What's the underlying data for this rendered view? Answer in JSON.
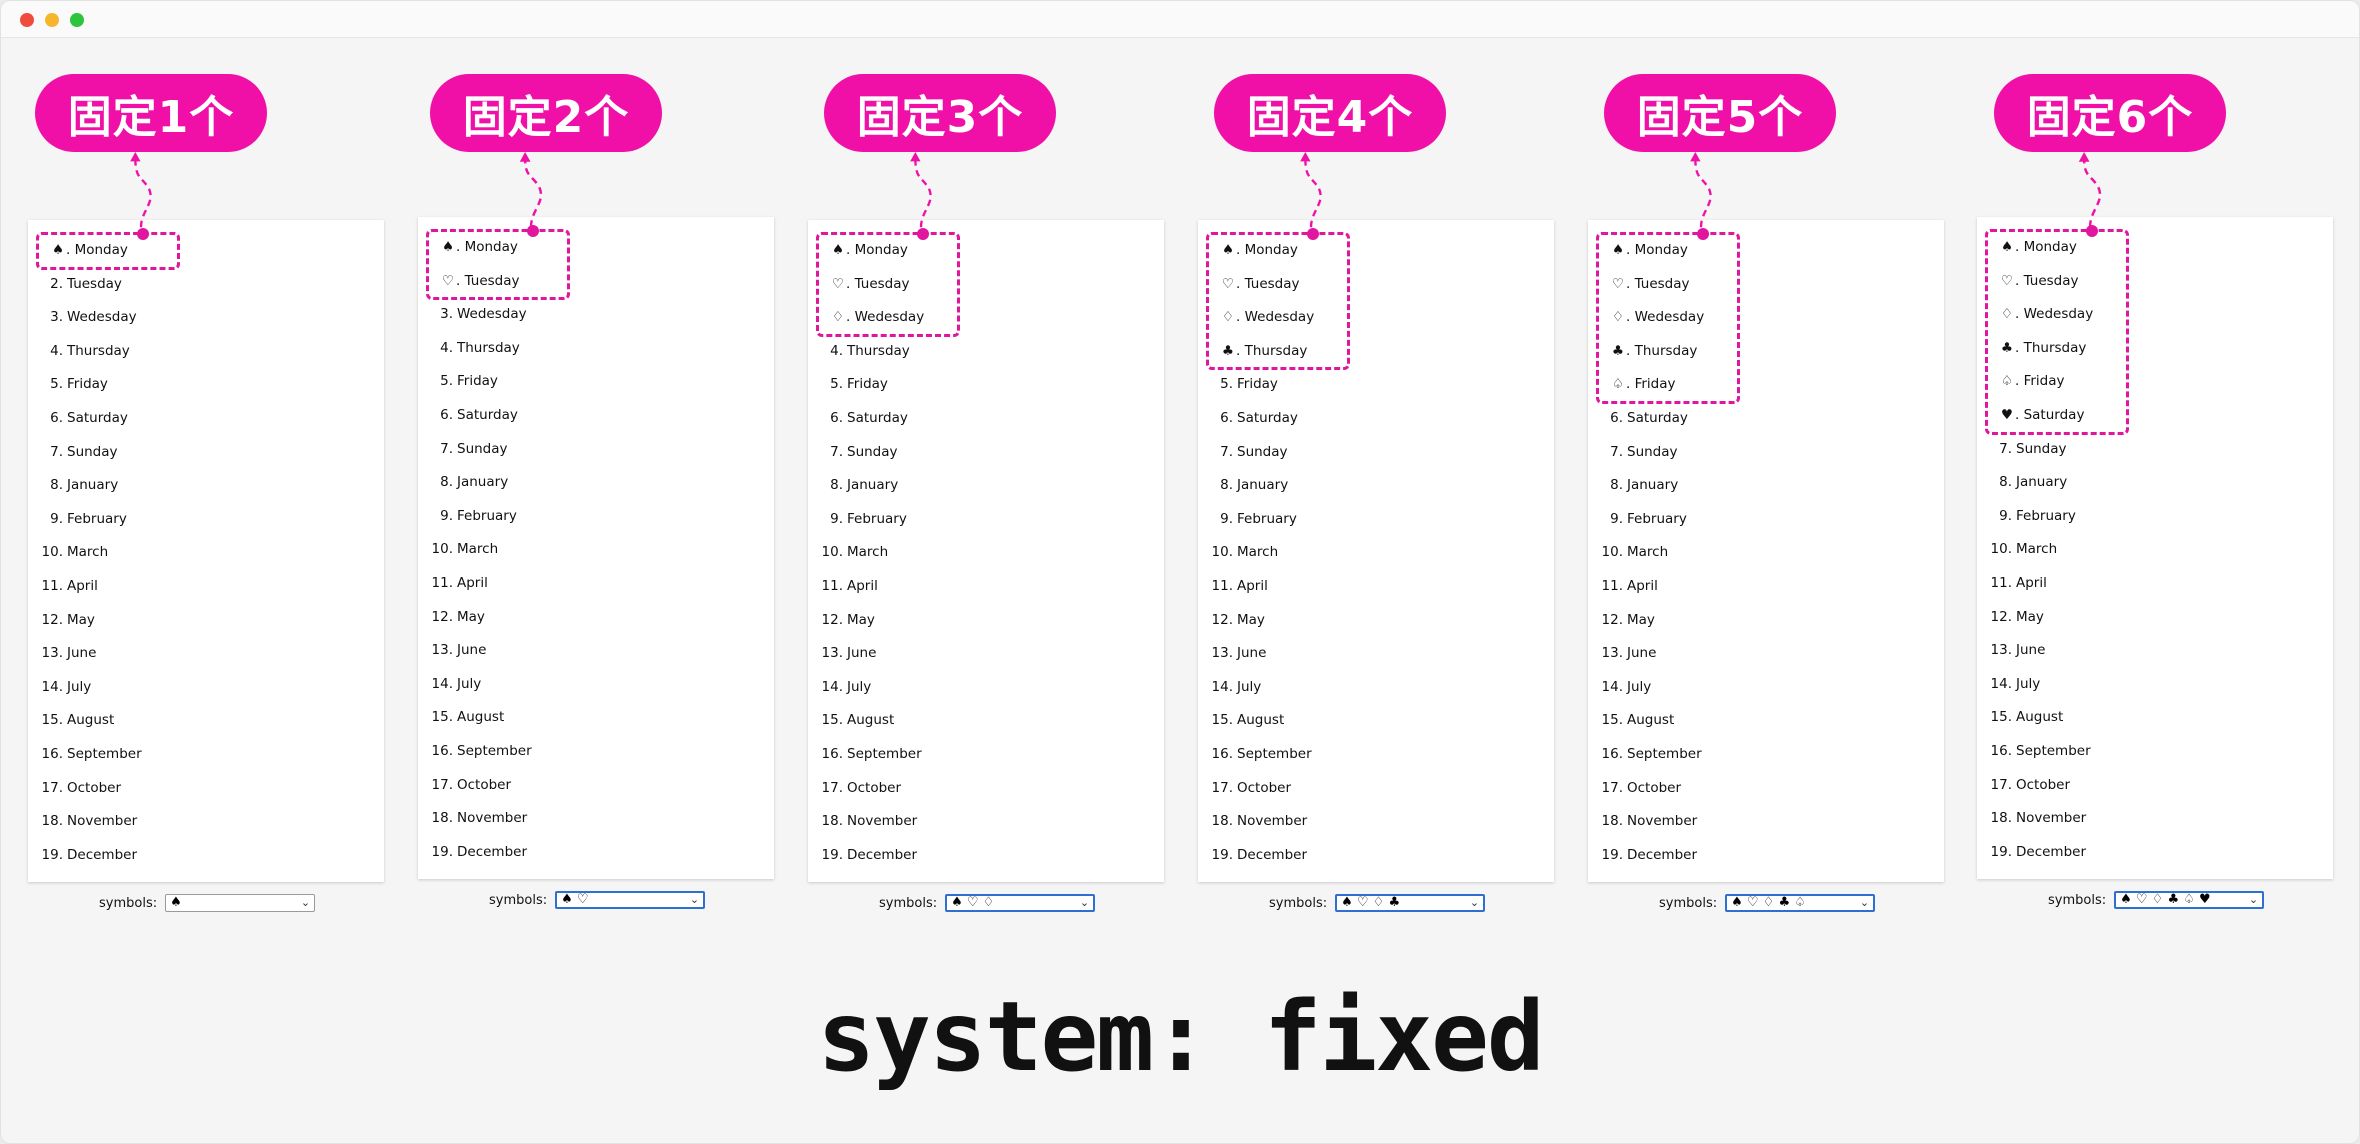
{
  "window": {
    "controls": [
      "close",
      "minimize",
      "zoom"
    ]
  },
  "accent_color": "#f010a8",
  "symbols_label": "symbols:",
  "footer_title": "system: fixed",
  "items": [
    "Monday",
    "Tuesday",
    "Wedesday",
    "Thursday",
    "Friday",
    "Saturday",
    "Sunday",
    "January",
    "February",
    "March",
    "April",
    "May",
    "June",
    "July",
    "August",
    "September",
    "October",
    "November",
    "December"
  ],
  "columns": [
    {
      "badge": "固定1个",
      "symbols": [
        "♠"
      ],
      "select_value": "♠",
      "focused": false
    },
    {
      "badge": "固定2个",
      "symbols": [
        "♠",
        "♡"
      ],
      "select_value": "♠ ♡",
      "focused": true
    },
    {
      "badge": "固定3个",
      "symbols": [
        "♠",
        "♡",
        "♢"
      ],
      "select_value": "♠ ♡ ♢",
      "focused": true
    },
    {
      "badge": "固定4个",
      "symbols": [
        "♠",
        "♡",
        "♢",
        "♣"
      ],
      "select_value": "♠ ♡ ♢ ♣",
      "focused": true
    },
    {
      "badge": "固定5个",
      "symbols": [
        "♠",
        "♡",
        "♢",
        "♣",
        "♤"
      ],
      "select_value": "♠ ♡ ♢ ♣ ♤",
      "focused": true
    },
    {
      "badge": "固定6个",
      "symbols": [
        "♠",
        "♡",
        "♢",
        "♣",
        "♤",
        "♥"
      ],
      "select_value": "♠ ♡ ♢ ♣ ♤ ♥",
      "focused": true
    }
  ]
}
